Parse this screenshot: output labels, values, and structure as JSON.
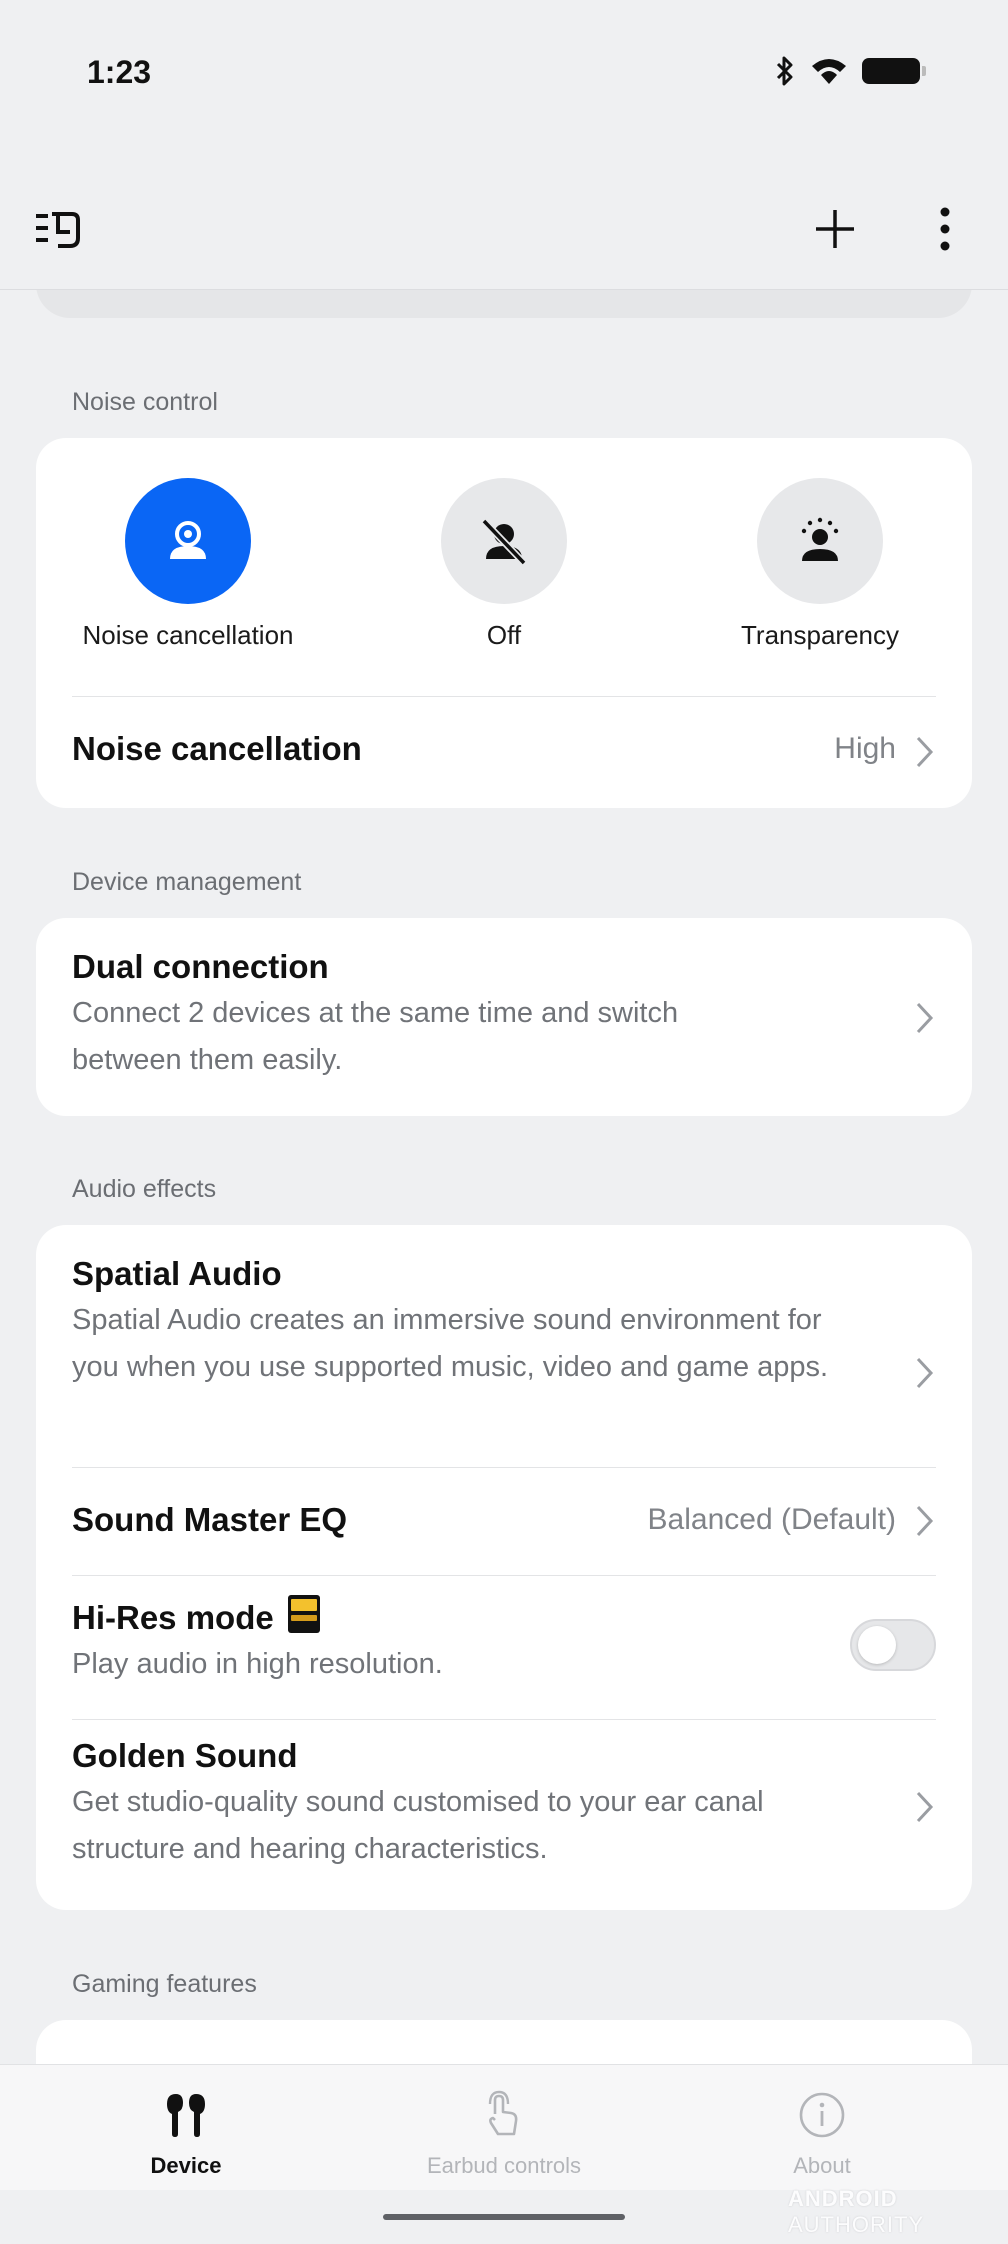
{
  "status_bar": {
    "time": "1:23",
    "icons": [
      "bluetooth-icon",
      "wifi-icon",
      "battery-icon"
    ]
  },
  "app_bar": {
    "left_icon": "device-switcher-icon",
    "actions": [
      "add-icon",
      "more-icon"
    ]
  },
  "noise_control": {
    "section_label": "Noise control",
    "modes": [
      {
        "label": "Noise cancellation",
        "icon": "noise-cancellation-icon",
        "selected": true
      },
      {
        "label": "Off",
        "icon": "off-icon",
        "selected": false
      },
      {
        "label": "Transparency",
        "icon": "transparency-icon",
        "selected": false
      }
    ],
    "setting": {
      "title": "Noise cancellation",
      "value": "High"
    }
  },
  "device_management": {
    "section_label": "Device management",
    "dual_connection": {
      "title": "Dual connection",
      "description": "Connect 2 devices at the same time and switch between them easily."
    }
  },
  "audio_effects": {
    "section_label": "Audio effects",
    "spatial_audio": {
      "title": "Spatial Audio",
      "description": "Spatial Audio creates an immersive sound environment for you when you use supported music, video and game apps."
    },
    "sound_master_eq": {
      "title": "Sound Master EQ",
      "value": "Balanced (Default)"
    },
    "hi_res_mode": {
      "title": "Hi-Res mode",
      "description": "Play audio in high resolution.",
      "enabled": false,
      "badge": "hi-res-audio-badge"
    },
    "golden_sound": {
      "title": "Golden Sound",
      "description": "Get studio-quality sound customised to your ear canal structure and hearing characteristics."
    }
  },
  "gaming_features": {
    "section_label": "Gaming features"
  },
  "bottom_nav": {
    "items": [
      {
        "label": "Device",
        "icon": "earbuds-icon",
        "active": true
      },
      {
        "label": "Earbud controls",
        "icon": "touch-gesture-icon",
        "active": false
      },
      {
        "label": "About",
        "icon": "info-icon",
        "active": false
      }
    ]
  },
  "colors": {
    "accent": "#0a66f5",
    "background": "#eff0f2",
    "card": "#ffffff",
    "secondary_text": "#707378"
  },
  "watermark": {
    "bold": "ANDROID",
    "light": "AUTHORITY"
  }
}
